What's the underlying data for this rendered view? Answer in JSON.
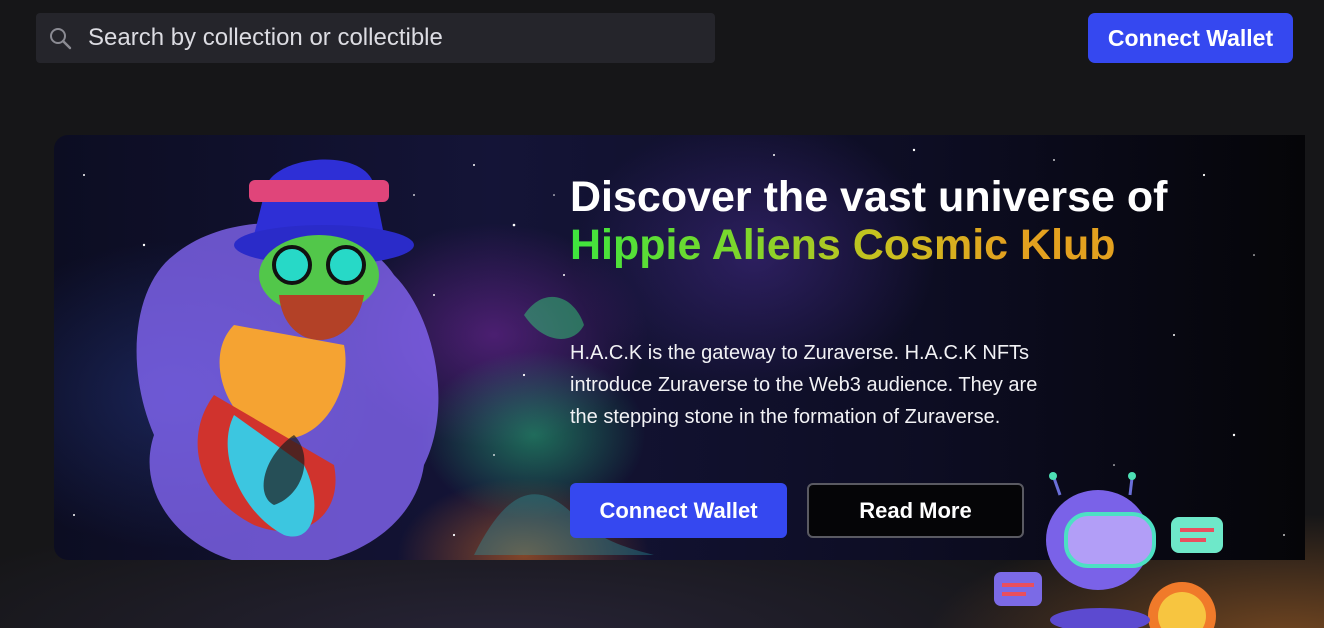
{
  "header": {
    "search": {
      "placeholder": "Search by collection or collectible",
      "icon": "search-icon"
    },
    "connect_wallet_label": "Connect Wallet"
  },
  "hero": {
    "title_part1": "Discover the vast universe of ",
    "title_highlight": "Hippie Aliens Cosmic",
    "title_part2": " Klub",
    "description": "H.A.C.K is the gateway to Zuraverse. H.A.C.K NFTs introduce Zuraverse to the Web3 audience. They are the stepping stone in the formation of Zuraverse.",
    "connect_wallet_label": "Connect Wallet",
    "read_more_label": "Read More"
  },
  "colors": {
    "background": "#161618",
    "accent": "#3548f0",
    "title_green": "#3ee53e",
    "title_gold": "#e3a11f"
  }
}
